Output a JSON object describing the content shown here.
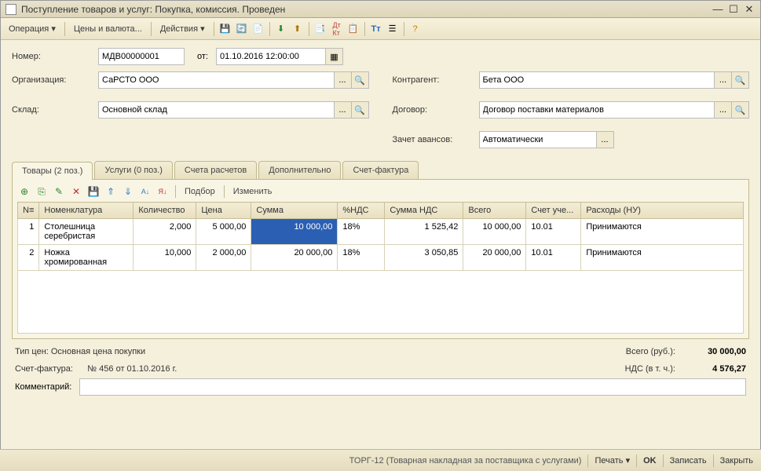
{
  "window": {
    "title": "Поступление товаров и услуг: Покупка, комиссия. Проведен"
  },
  "menu": {
    "operation": "Операция ▾",
    "prices": "Цены и валюта...",
    "actions": "Действия ▾"
  },
  "form": {
    "number_label": "Номер:",
    "number": "МДВ00000001",
    "from_label": "от:",
    "date": "01.10.2016 12:00:00",
    "org_label": "Организация:",
    "org": "СаРСТО ООО",
    "sklad_label": "Склад:",
    "sklad": "Основной склад",
    "contr_label": "Контрагент:",
    "contr": "Бета ООО",
    "dogovor_label": "Договор:",
    "dogovor": "Договор поставки материалов",
    "avans_label": "Зачет авансов:",
    "avans": "Автоматически"
  },
  "tabs": {
    "goods": "Товары (2 поз.)",
    "services": "Услуги (0 поз.)",
    "accounts": "Счета расчетов",
    "additional": "Дополнительно",
    "invoice": "Счет-фактура"
  },
  "rowtoolbar": {
    "podbor": "Подбор",
    "change": "Изменить"
  },
  "grid": {
    "headers": {
      "n": "N≡",
      "nomen": "Номенклатура",
      "qty": "Количество",
      "price": "Цена",
      "sum": "Сумма",
      "vatp": "%НДС",
      "vatsum": "Сумма НДС",
      "total": "Всего",
      "acct": "Счет уче...",
      "exp": "Расходы (НУ)"
    },
    "rows": [
      {
        "n": "1",
        "nomen": "Столешница серебристая",
        "qty": "2,000",
        "price": "5 000,00",
        "sum": "10 000,00",
        "vatp": "18%",
        "vatsum": "1 525,42",
        "total": "10 000,00",
        "acct": "10.01",
        "exp": "Принимаются"
      },
      {
        "n": "2",
        "nomen": "Ножка хромированная",
        "qty": "10,000",
        "price": "2 000,00",
        "sum": "20 000,00",
        "vatp": "18%",
        "vatsum": "3 050,85",
        "total": "20 000,00",
        "acct": "10.01",
        "exp": "Принимаются"
      }
    ]
  },
  "footer": {
    "price_type": "Тип цен: Основная цена покупки",
    "total_label": "Всего (руб.):",
    "total": "30 000,00",
    "sf_label": "Счет-фактура:",
    "sf_value": "№ 456 от 01.10.2016 г.",
    "vat_label": "НДС (в т. ч.):",
    "vat": "4 576,27",
    "comment_label": "Комментарий:",
    "comment": ""
  },
  "status": {
    "torg": "ТОРГ-12 (Товарная накладная за поставщика с услугами)",
    "print": "Печать ▾",
    "ok": "OK",
    "save": "Записать",
    "close": "Закрыть"
  }
}
